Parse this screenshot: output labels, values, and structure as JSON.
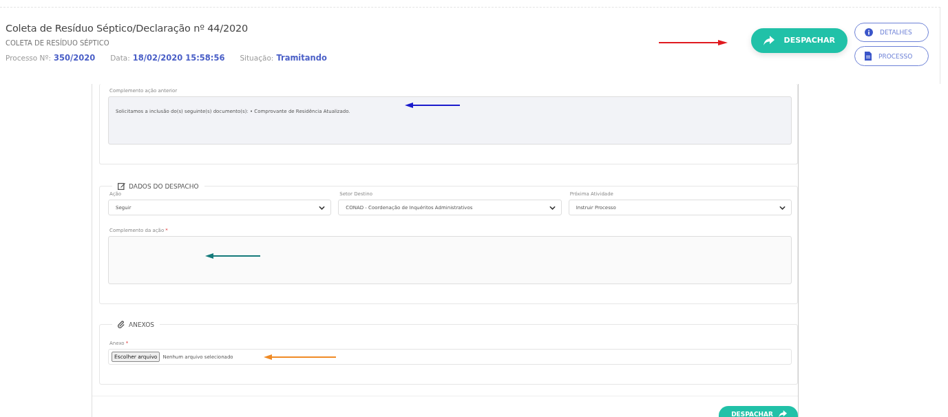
{
  "header": {
    "title": "Coleta de Resíduo Séptico/Declaração nº 44/2020",
    "subtitle": "COLETA DE RESÍDUO SÉPTICO",
    "meta": [
      {
        "label": "Processo Nº:",
        "value": "350/2020"
      },
      {
        "label": "Data:",
        "value": "18/02/2020 15:58:56"
      },
      {
        "label": "Situação:",
        "value": "Tramitando"
      }
    ]
  },
  "header_buttons": [
    {
      "kind": "primary",
      "label": "DESPACHAR"
    },
    {
      "kind": "outline",
      "label": "DETALHES"
    },
    {
      "kind": "outline",
      "label": "PROCESSO"
    }
  ],
  "previous_action": {
    "label": "Complemento ação anterior",
    "value": "Solicitamos a inclusão do(s) seguinte(s) documento(s): • Comprovante de Residência Atualizado."
  },
  "dispatch": {
    "legend": "DADOS DO DESPACHO",
    "selects": [
      {
        "label": "Ação",
        "value": "Seguir"
      },
      {
        "label": "Setor Destino",
        "value": "CONAD - Coordenação de Inquéritos Administrativos"
      },
      {
        "label": "Próxima Atividade",
        "value": "Instruir Processo"
      }
    ],
    "complement": {
      "label": "Complemento da ação",
      "required_mark": "*"
    }
  },
  "attachments": {
    "legend": "ANEXOS",
    "label": "Anexo",
    "required_mark": "*",
    "button": "Escolher arquivo",
    "status": "Nenhum arquivo selecionado"
  },
  "submit": {
    "label": "DESPACHAR"
  }
}
